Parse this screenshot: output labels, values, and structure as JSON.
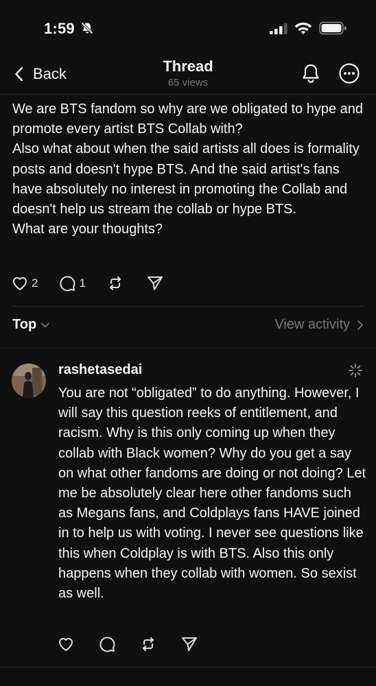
{
  "status_bar": {
    "time": "1:59",
    "icons": [
      "bell-slash-icon",
      "cellular-signal-icon",
      "wifi-icon",
      "battery-icon"
    ]
  },
  "nav": {
    "back_label": "Back",
    "title": "Thread",
    "subtitle": "65 views",
    "icons": [
      "chevron-left-icon",
      "bell-icon",
      "more-icon"
    ]
  },
  "post": {
    "lines": [
      "We are BTS fandom so why are we obligated to hype and promote every artist BTS Collab with?",
      "Also what about when the said artists all does is formality posts and doesn't hype BTS. And the said artist's fans have absolutely no interest in promoting the Collab and doesn't help us stream the collab or hype BTS.",
      "What are your thoughts?"
    ],
    "likes": "2",
    "replies": "1"
  },
  "sort": {
    "label": "Top",
    "view_activity": "View activity"
  },
  "reply": {
    "username": "rashetasedai",
    "text": "You are not “obligated” to do anything. However, I will say this question reeks of entitlement, and racism. Why is this only coming up when they collab with Black women? Why do you get a say on what other fandoms are doing or not doing? Let me be absolutely clear here other fandoms such as Megans fans, and Coldplays fans HAVE joined in to help us with voting. I never see questions like this when Coldplay is with BTS. Also this only happens when they collab with women. So sexist as well."
  },
  "colors": {
    "background": "#101010",
    "text": "#f3f5f7",
    "muted": "#777777",
    "divider": "#2a2a2a"
  }
}
